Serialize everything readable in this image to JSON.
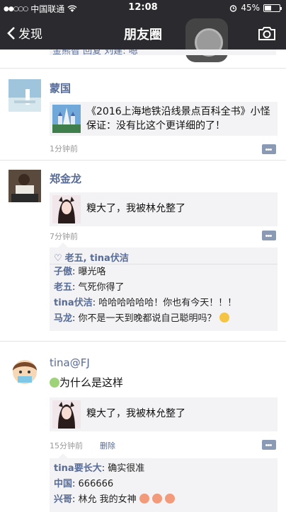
{
  "status_bar": {
    "carrier": "中国联通",
    "time": "12:08",
    "battery": "45%",
    "battery_level": 0.45
  },
  "nav": {
    "back_label": "发现",
    "title": "朋友圈"
  },
  "feed": {
    "cut_comment": "金熊智 回复 刘建: 嗯",
    "posts": [
      {
        "name": "蒙国",
        "share_text": "《2016上海地铁沿线景点百科全书》小怪保证：没有比这个更详细的了！",
        "time": "1分钟前"
      },
      {
        "name": "郑金龙",
        "share_text": "糗大了，我被林允整了",
        "time": "7分钟前",
        "likes": "老五, tina伏洁",
        "comments": [
          {
            "author": "子傲",
            "text": ": 曝光咯"
          },
          {
            "author": "老五",
            "text": ": 气死你得了"
          },
          {
            "author": "tina伏洁",
            "text": ": 哈哈哈哈哈哈！你也有今天！！！"
          },
          {
            "author": "马龙",
            "text": ": 你不是一天到晚都说自己聪明吗？"
          }
        ]
      },
      {
        "name": "tina@FJ",
        "text": "为什么是这样",
        "share_text": "糗大了，我被林允整了",
        "time": "15分钟前",
        "delete_label": "删除",
        "comments": [
          {
            "author": "tina要长大",
            "text": ": 确实很准"
          },
          {
            "author": "中国",
            "text": ": 666666"
          },
          {
            "author": "兴哥",
            "text": ": 林允 我的女神"
          }
        ]
      }
    ]
  },
  "icons": [
    "back-arrow-icon",
    "camera-icon",
    "wifi-icon",
    "alarm-icon",
    "heart-icon",
    "more-icon",
    "emoji-icon"
  ],
  "colors": {
    "bar": "#2b2b2f",
    "link": "#576b95",
    "panel": "#f3f3f5"
  }
}
